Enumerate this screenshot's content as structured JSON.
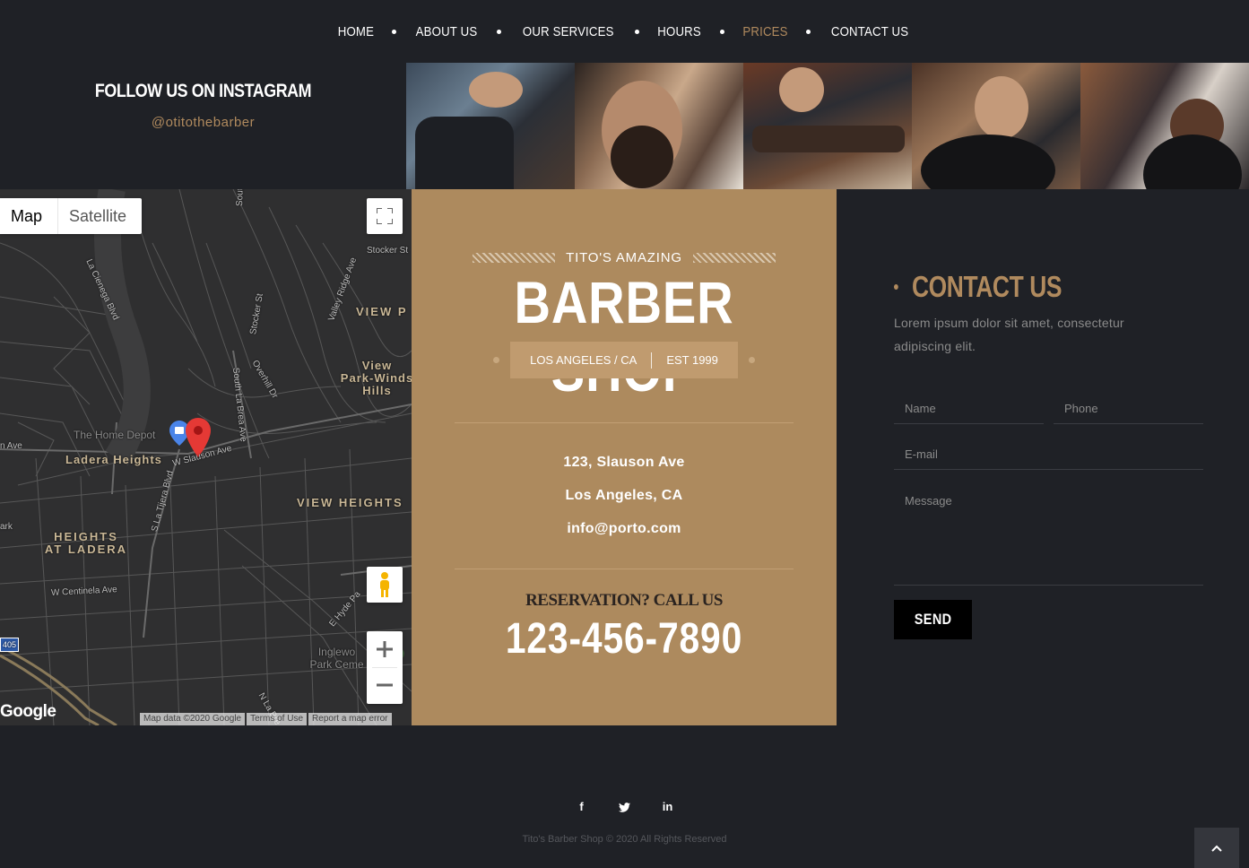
{
  "nav": {
    "items": [
      {
        "label": "HOME"
      },
      {
        "label": "ABOUT US"
      },
      {
        "label": "OUR SERVICES"
      },
      {
        "label": "HOURS"
      },
      {
        "label": "PRICES",
        "active": true
      },
      {
        "label": "CONTACT US"
      }
    ]
  },
  "instagram": {
    "title": "FOLLOW US ON INSTAGRAM",
    "handle": "@otitothebarber"
  },
  "map": {
    "type_map": "Map",
    "type_satellite": "Satellite",
    "labels": {
      "view_park": "VIEW P",
      "view_park_windsor": "View\nPark-Winds\nHills",
      "ladera_heights": "Ladera Heights",
      "view_heights": "VIEW HEIGHTS",
      "heights_at_ladera": "HEIGHTS\nAT LADERA",
      "home_depot": "The Home Depot",
      "inglewood": "Inglewo\nPark Ceme",
      "w_slauson": "W Slauson Ave",
      "stocker": "Stocker St",
      "la_cienega": "La Cienega Blvd",
      "valley_ridge": "Valley Ridge Ave",
      "south_la_brea": "South La Brea Ave",
      "overhill": "Overhill Dr",
      "s_la_tijera": "S La Tijera Blvd",
      "w_centinela": "W Centinela Ave",
      "e_hyde_park": "E Hyde Pa",
      "n_la_brea": "N La Bre",
      "south": "South",
      "n_ave": "n Ave",
      "ark": "ark",
      "stocker_st": "Stocker St",
      "highway": "405"
    },
    "google": "Google",
    "footer": {
      "data": "Map data ©2020 Google",
      "terms": "Terms of Use",
      "report": "Report a map error"
    }
  },
  "card": {
    "subtitle": "TITO'S AMAZING",
    "title": "BARBER SHOP",
    "location": "LOS ANGELES / CA",
    "established": "EST 1999",
    "address_line1": "123, Slauson Ave",
    "address_line2": "Los Angeles, CA",
    "email": "info@porto.com",
    "reservation": "RESERVATION? CALL US",
    "phone": "123-456-7890"
  },
  "contact": {
    "title": "CONTACT US",
    "description": "Lorem ipsum dolor sit amet, consectetur adipiscing elit.",
    "name_placeholder": "Name",
    "phone_placeholder": "Phone",
    "email_placeholder": "E-mail",
    "message_placeholder": "Message",
    "send_label": "SEND"
  },
  "footer": {
    "social": {
      "facebook": "f",
      "twitter": "t",
      "linkedin": "in"
    },
    "copyright": "Tito's Barber Shop © 2020 All Rights Reserved"
  },
  "colors": {
    "background": "#1f2126",
    "accent": "#b08a5e",
    "card": "#ad8a5e"
  }
}
